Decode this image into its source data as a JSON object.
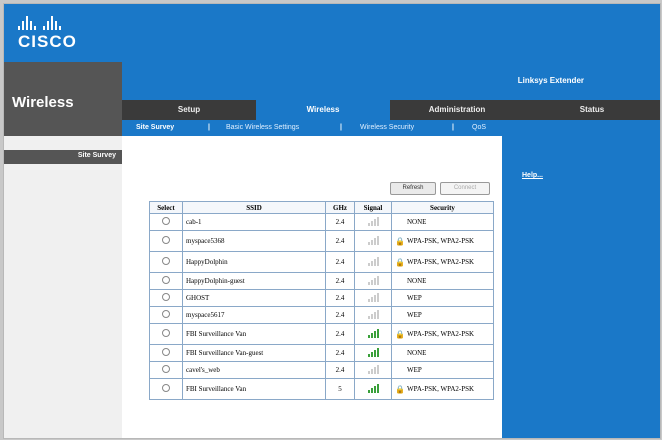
{
  "brand": {
    "logo_text": "CISCO",
    "logo_icon": "cisco-bridge-logo"
  },
  "header": {
    "section_title": "Wireless",
    "product_name": "Linksys Extender"
  },
  "tabs": [
    {
      "label": "Setup",
      "active": false
    },
    {
      "label": "Wireless",
      "active": true
    },
    {
      "label": "Administration",
      "active": false
    },
    {
      "label": "Status",
      "active": false
    }
  ],
  "subtabs": [
    {
      "label": "Site Survey",
      "active": true
    },
    {
      "label": "Basic Wireless Settings",
      "active": false
    },
    {
      "label": "Wireless Security",
      "active": false
    },
    {
      "label": "QoS",
      "active": false
    }
  ],
  "subtab_separator": "|",
  "sidebar": {
    "label": "Site Survey"
  },
  "buttons": {
    "refresh": "Refresh",
    "connect": "Connect"
  },
  "help": {
    "label": "Help..."
  },
  "table": {
    "columns": [
      "Select",
      "SSID",
      "GHz",
      "Signal",
      "Security"
    ],
    "rows": [
      {
        "ssid": "cab-1",
        "ghz": "2.4",
        "signal": "weak",
        "security": "NONE",
        "secure": false
      },
      {
        "ssid": "myspace5368",
        "ghz": "2.4",
        "signal": "weak",
        "security": "WPA-PSK, WPA2-PSK",
        "secure": true
      },
      {
        "ssid": "HappyDolphin",
        "ghz": "2.4",
        "signal": "weak",
        "security": "WPA-PSK, WPA2-PSK",
        "secure": true
      },
      {
        "ssid": "HappyDolphin-guest",
        "ghz": "2.4",
        "signal": "weak",
        "security": "NONE",
        "secure": false
      },
      {
        "ssid": "GHOST",
        "ghz": "2.4",
        "signal": "weak",
        "security": "WEP",
        "secure": false
      },
      {
        "ssid": "myspace5617",
        "ghz": "2.4",
        "signal": "weak",
        "security": "WEP",
        "secure": false
      },
      {
        "ssid": "FBI Surveillance Van",
        "ghz": "2.4",
        "signal": "strong",
        "security": "WPA-PSK, WPA2-PSK",
        "secure": true
      },
      {
        "ssid": "FBI Surveillance Van-guest",
        "ghz": "2.4",
        "signal": "strong",
        "security": "NONE",
        "secure": false
      },
      {
        "ssid": "cavel's_web",
        "ghz": "2.4",
        "signal": "weak",
        "security": "WEP",
        "secure": false
      },
      {
        "ssid": "FBI Surveillance Van",
        "ghz": "5",
        "signal": "strong",
        "security": "WPA-PSK, WPA2-PSK",
        "secure": true
      }
    ]
  },
  "colors": {
    "accent": "#1a78c8",
    "nav_dark": "#3a3a3a",
    "header_gray": "#555555",
    "signal_strong": "#3aa03a"
  }
}
